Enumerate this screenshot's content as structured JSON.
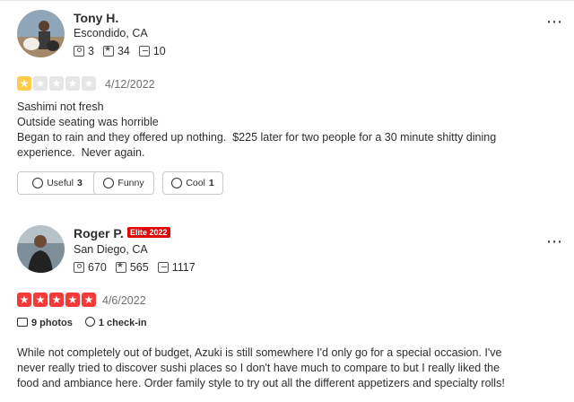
{
  "reviews": [
    {
      "name": "Tony H.",
      "location": "Escondido, CA",
      "stats": {
        "friends": "3",
        "reviews": "34",
        "photos": "10"
      },
      "rating": 1,
      "date": "4/12/2022",
      "lines": [
        "Sashimi not fresh",
        "Outside seating was horrible",
        "Began to rain and they offered up nothing.  $225 later for two people for a 30 minute shitty dining",
        "experience.  Never again."
      ],
      "buttons": {
        "useful": "Useful",
        "useful_count": "3",
        "funny": "Funny",
        "cool": "Cool",
        "cool_count": "1"
      }
    },
    {
      "name": "Roger P.",
      "elite": "Elite 2022",
      "location": "San Diego, CA",
      "stats": {
        "friends": "670",
        "reviews": "565",
        "photos": "1117"
      },
      "rating": 5,
      "date": "4/6/2022",
      "photos_label": "9 photos",
      "checkin_label": "1 check-in",
      "lines": [
        "While not completely out of budget, Azuki is still somewhere I'd only go for a special occasion. I've",
        "never really tried to discover sushi places so I don't have much to compare to but I really liked the",
        "food and ambiance here. Order family style to try out all the different appetizers and specialty rolls!"
      ]
    }
  ],
  "more_label": "⋮⋮⋮",
  "colors": {
    "star_one": "#ffcc4b",
    "star_five": "#f43939",
    "elite": "#e00707"
  }
}
